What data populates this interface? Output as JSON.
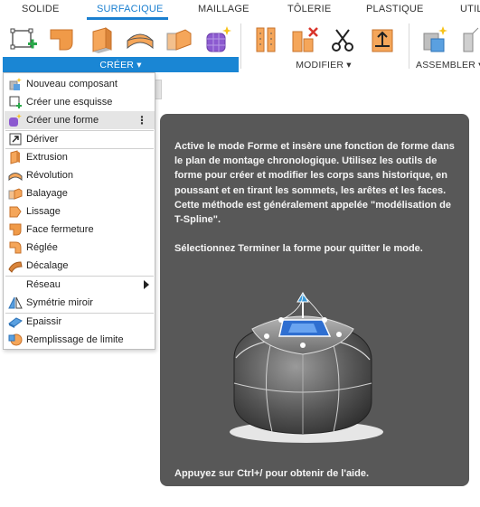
{
  "tabs": [
    {
      "label": "SOLIDE"
    },
    {
      "label": "SURFACIQUE"
    },
    {
      "label": "MAILLAGE"
    },
    {
      "label": "TÔLERIE"
    },
    {
      "label": "PLASTIQUE"
    },
    {
      "label": "UTILI"
    }
  ],
  "active_tab": "SURFACIQUE",
  "ribbon": {
    "create_label": "CRÉER ▾",
    "modify_label": "MODIFIER ▾",
    "assemble_label": "ASSEMBLER ▾"
  },
  "menu": {
    "items": [
      {
        "label": "Nouveau composant",
        "icon": "new-component-icon"
      },
      {
        "label": "Créer une esquisse",
        "icon": "sketch-icon"
      },
      {
        "label": "Créer une forme",
        "icon": "form-icon",
        "more": "⋮"
      },
      {
        "label": "Dériver",
        "icon": "derive-icon"
      },
      {
        "label": "Extrusion",
        "icon": "extrude-icon"
      },
      {
        "label": "Révolution",
        "icon": "revolve-icon"
      },
      {
        "label": "Balayage",
        "icon": "sweep-icon"
      },
      {
        "label": "Lissage",
        "icon": "loft-icon"
      },
      {
        "label": "Face fermeture",
        "icon": "patch-icon"
      },
      {
        "label": "Réglée",
        "icon": "ruled-icon"
      },
      {
        "label": "Décalage",
        "icon": "offset-icon"
      },
      {
        "label": "Réseau",
        "icon": ""
      },
      {
        "label": "Symétrie miroir",
        "icon": "mirror-icon"
      },
      {
        "label": "Epaissir",
        "icon": "thicken-icon"
      },
      {
        "label": "Remplissage de limite",
        "icon": "boundary-fill-icon"
      }
    ]
  },
  "tooltip": {
    "paragraph1": "Active le mode Forme et insère une fonction de forme dans le plan de montage chronologique. Utilisez les outils de forme pour créer et modifier les corps sans historique, en poussant et en tirant les sommets, les arêtes et les faces. Cette méthode est généralement appelée \"modélisation de T-Spline\".",
    "paragraph2": "Sélectionnez Terminer la forme pour quitter le mode.",
    "footer": "Appuyez sur Ctrl+/ pour obtenir de l'aide."
  },
  "colors": {
    "accent": "#1a86d4",
    "tooltip_bg": "#585858",
    "highlight": "#e5e5e5"
  }
}
